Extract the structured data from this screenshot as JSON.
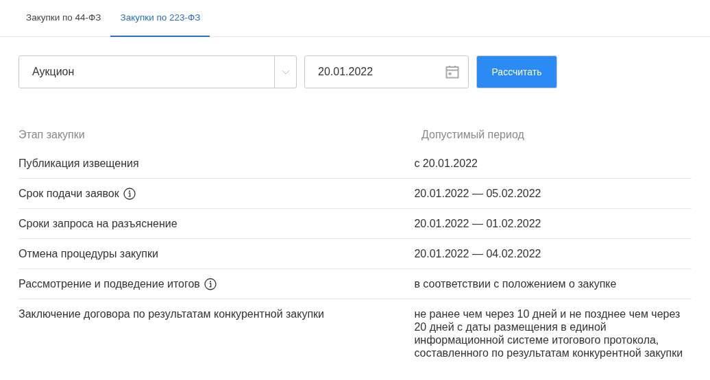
{
  "tabs": [
    {
      "label": "Закупки по 44-ФЗ",
      "selected": false
    },
    {
      "label": "Закупки по 223-ФЗ",
      "selected": true
    }
  ],
  "form": {
    "procedure_select": {
      "value": "Аукцион"
    },
    "date_field": {
      "value": "20.01.2022"
    },
    "submit_button": "Рассчитать"
  },
  "table": {
    "columns": [
      "Этап закупки",
      "Допустимый период"
    ],
    "rows": [
      {
        "stage": "Публикация извещения",
        "info": false,
        "period": "с 20.01.2022"
      },
      {
        "stage": "Срок подачи заявок",
        "info": true,
        "period": "20.01.2022 — 05.02.2022"
      },
      {
        "stage": "Сроки запроса на разъяснение",
        "info": false,
        "period": "20.01.2022 — 01.02.2022"
      },
      {
        "stage": "Отмена процедуры закупки",
        "info": false,
        "period": "20.01.2022 — 04.02.2022"
      },
      {
        "stage": "Рассмотрение и подведение итогов",
        "info": true,
        "period": "в соответствии с положением о закупке"
      },
      {
        "stage": "Заключение договора по результатам конкурентной закупки",
        "info": false,
        "period": "не ранее чем через 10 дней и не позднее чем через 20 дней с даты размещения в единой информационной системе итогового протокола, составленного по результатам конкурентной закупки"
      }
    ]
  }
}
